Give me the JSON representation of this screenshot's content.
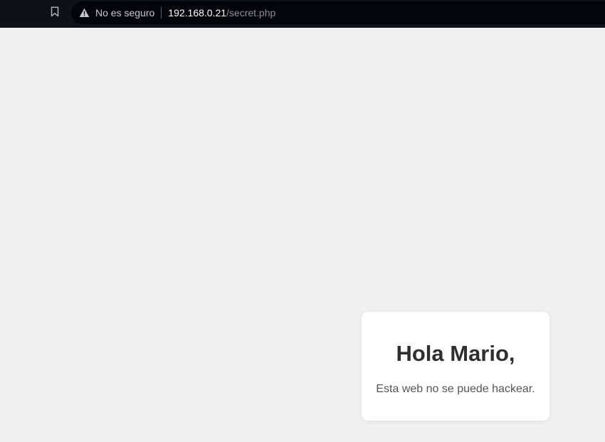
{
  "browser": {
    "security_label": "No es seguro",
    "url_host": "192.168.0.21",
    "url_path": "/secret.php",
    "icons": {
      "bookmark": "bookmark-icon",
      "security": "warning-icon"
    },
    "colors": {
      "toolbar": "#0f1117",
      "omnibox": "#03050a",
      "page_background": "#f0f0f0"
    }
  },
  "page": {
    "card": {
      "title": "Hola Mario,",
      "message": "Esta web no se puede hackear."
    }
  }
}
